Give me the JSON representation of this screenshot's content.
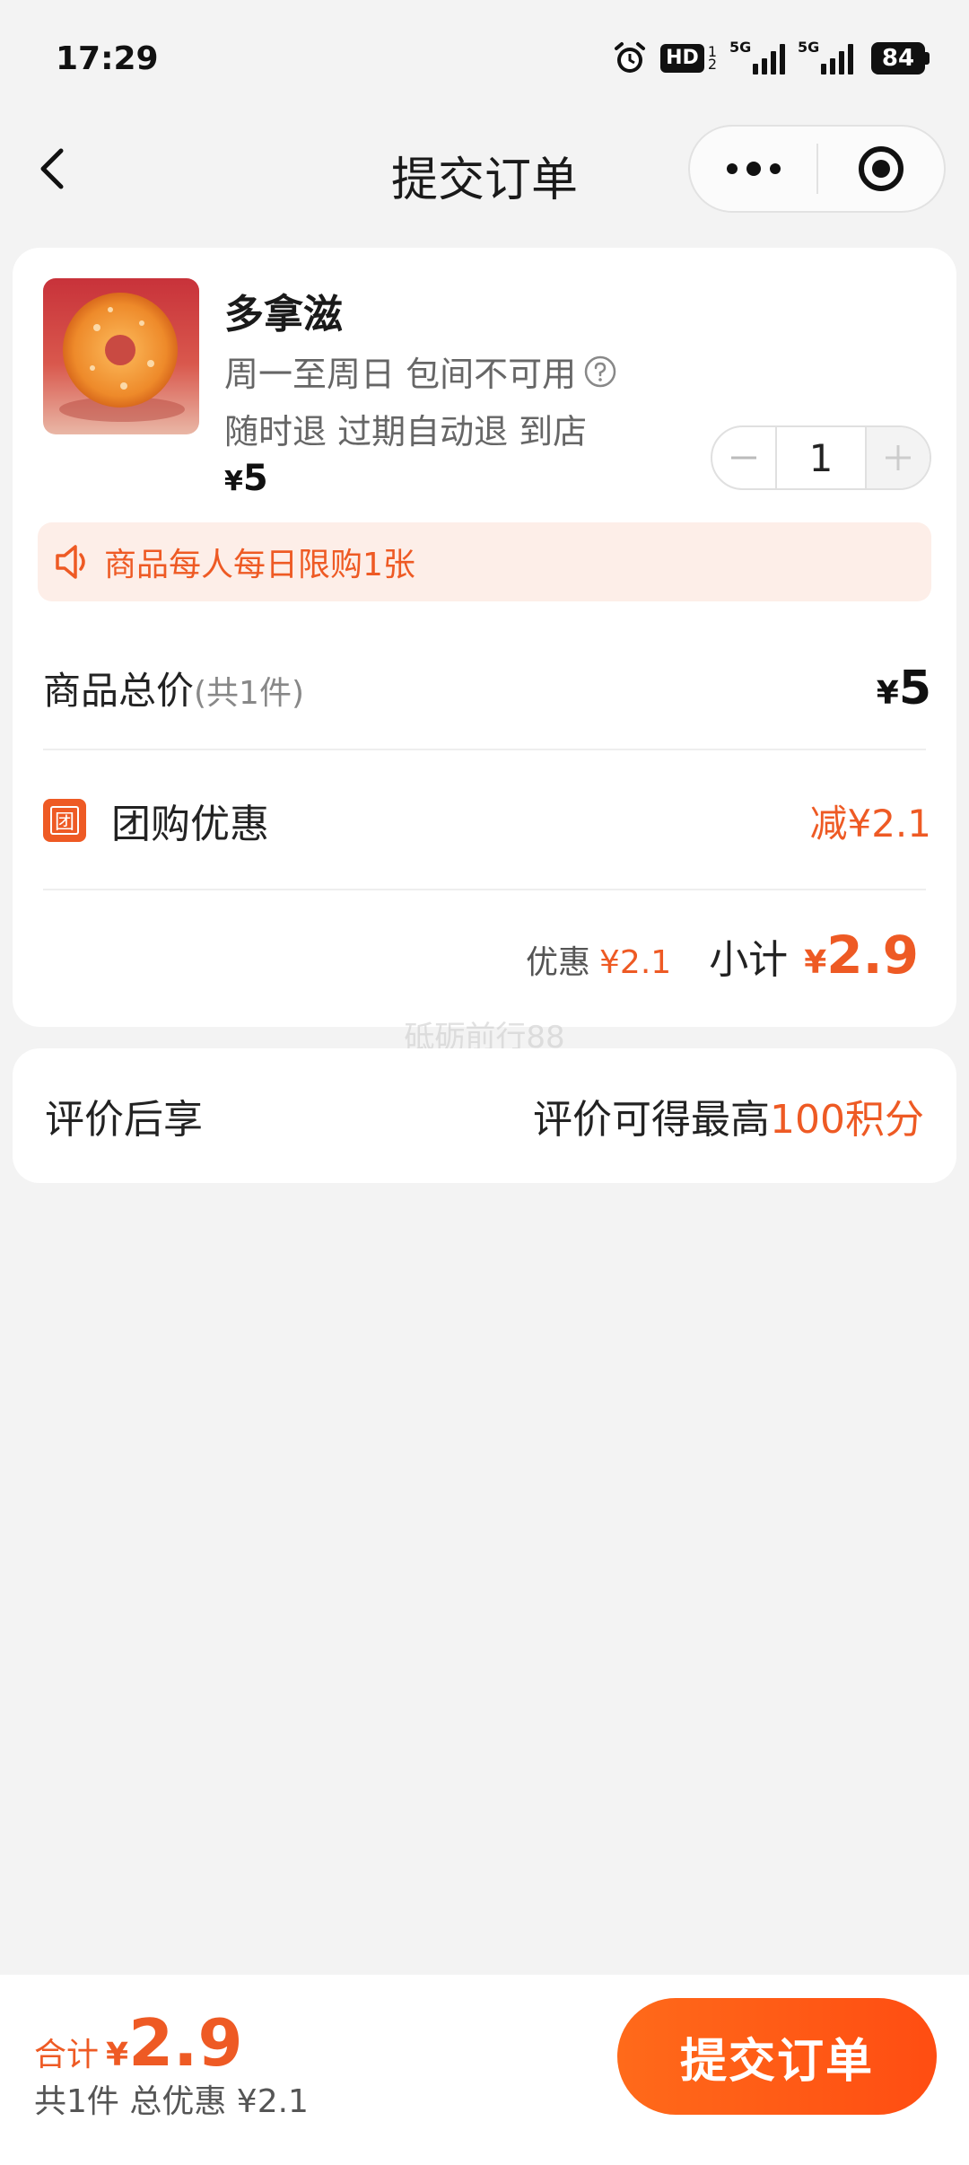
{
  "status_bar": {
    "time": "17:29",
    "hd_label": "HD",
    "hd_sub_top": "1",
    "hd_sub_bottom": "2",
    "signal1_tag": "5G",
    "signal2_tag": "5G",
    "battery": "84"
  },
  "nav": {
    "title": "提交订单"
  },
  "product": {
    "name": "多拿滋",
    "line1": "周一至周日 包间不可用",
    "line2": "随时退 过期自动退 到店",
    "price_symbol": "¥",
    "price": "5",
    "quantity": "1"
  },
  "limit_notice": "商品每人每日限购1张",
  "summary": {
    "total_label": "商品总价",
    "total_count": "(共1件)",
    "total_symbol": "¥",
    "total_value": "5",
    "discount_icon": "团",
    "discount_label": "团购优惠",
    "discount_value": "减¥2.1",
    "subtotal_discount_label": "优惠",
    "subtotal_discount_value": "¥2.1",
    "subtotal_label": "小计",
    "subtotal_symbol": "¥",
    "subtotal_value": "2.9"
  },
  "watermark": "砥砺前行88",
  "review": {
    "label": "评价后享",
    "text": "评价可得最高",
    "points": "100积分"
  },
  "bottom": {
    "total_label": "合计",
    "total_symbol": "¥",
    "total_value": "2.9",
    "summary": "共1件 总优惠 ¥2.1",
    "submit_label": "提交订单"
  },
  "icons": {
    "back": "chevron-left-icon",
    "more": "more-dots-icon",
    "close": "target-circle-icon",
    "help": "question-circle-icon",
    "speaker": "speaker-icon",
    "minus": "minus-icon",
    "plus": "plus-icon"
  },
  "colors": {
    "accent": "#ee5a24",
    "banner_bg": "#fdeee8",
    "page_bg": "#f3f3f3"
  }
}
